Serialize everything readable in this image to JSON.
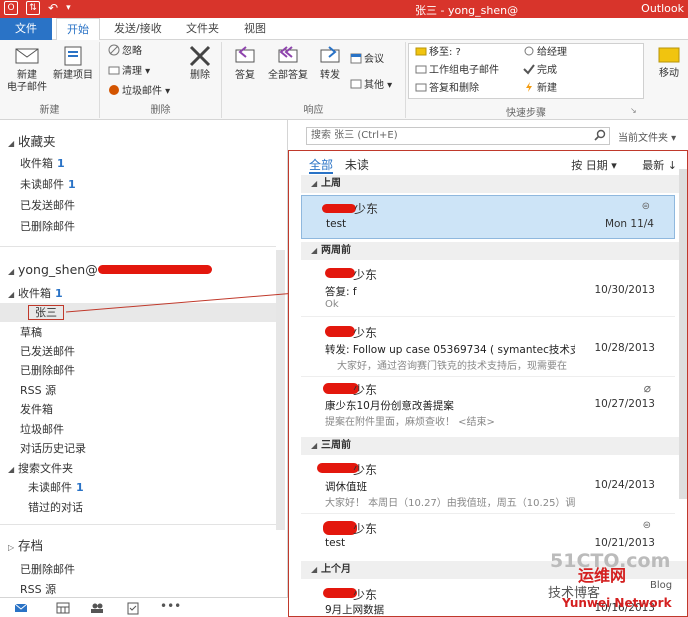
{
  "titlebar": {
    "title": "张三 - yong_shen@",
    "app": "Outlook"
  },
  "tabs": [
    "文件",
    "开始",
    "发送/接收",
    "文件夹",
    "视图"
  ],
  "ribbon": {
    "new_group": {
      "label": "新建",
      "new_email": "新建\n电子邮件",
      "new_items": "新建项目"
    },
    "delete_group": {
      "label": "删除",
      "ignore": "忽略",
      "clean": "清理",
      "junk": "垃圾邮件",
      "delete": "删除"
    },
    "respond_group": {
      "label": "响应",
      "reply": "答复",
      "reply_all": "全部答复",
      "forward": "转发",
      "meeting": "会议",
      "more": "其他"
    },
    "quicksteps_group": {
      "label": "快速步骤",
      "move_to": "移至: ?",
      "to_manager": "给经理",
      "team_email": "工作组电子邮件",
      "done": "完成",
      "reply_delete": "答复和删除",
      "create_new": "新建"
    },
    "move_group": {
      "move": "移动"
    }
  },
  "nav": {
    "favorites_header": "收藏夹",
    "favorites": [
      {
        "label": "收件箱",
        "count": "1"
      },
      {
        "label": "未读邮件",
        "count": "1"
      },
      {
        "label": "已发送邮件",
        "count": ""
      },
      {
        "label": "已删除邮件",
        "count": ""
      }
    ],
    "account": "yong_shen@",
    "inbox": {
      "label": "收件箱",
      "count": "1"
    },
    "subfolder": "张三",
    "folders": [
      "草稿",
      "已发送邮件",
      "已删除邮件",
      "RSS 源",
      "发件箱",
      "垃圾邮件",
      "对话历史记录"
    ],
    "search_folders": "搜索文件夹",
    "search_sub": [
      {
        "label": "未读邮件",
        "count": "1"
      },
      {
        "label": "错过的对话",
        "count": ""
      }
    ],
    "archive": "存档",
    "archive_items": [
      "已删除邮件",
      "RSS 源"
    ]
  },
  "search": {
    "placeholder": "搜索 张三 (Ctrl+E)",
    "scope": "当前文件夹"
  },
  "list": {
    "filter_all": "全部",
    "filter_unread": "未读",
    "sort_by": "按 日期",
    "sort_order": "最新",
    "groups": [
      "上周",
      "两周前",
      "三周前",
      "上个月"
    ],
    "items": [
      {
        "from": "少东",
        "subject": "test",
        "preview": "",
        "date": "Mon 11/4"
      },
      {
        "from": "少东",
        "subject": "答复: f",
        "preview": "Ok",
        "date": "10/30/2013"
      },
      {
        "from": "少东",
        "subject": "转发: Follow up case 05369734 ( symantec技术支...",
        "preview": "大家好，通过咨询赛门铁克的技术支持后，现需要在",
        "date": "10/28/2013"
      },
      {
        "from": "少东",
        "subject": "康少东10月份创意改善提案",
        "preview": "提案在附件里面，麻烦查收！ <结束>",
        "date": "10/27/2013"
      },
      {
        "from": "少东",
        "subject": "调休值班",
        "preview": "大家好！ 本周日（10.27）由我值班，周五（10.25）调",
        "date": "10/24/2013"
      },
      {
        "from": "少东",
        "subject": "test",
        "preview": "",
        "date": "10/21/2013"
      },
      {
        "from": "少东",
        "subject": "9月上网数据",
        "preview": "",
        "date": "10/16/2013"
      }
    ]
  },
  "watermark": {
    "line1": "51CTO.com",
    "line2": "技术博客",
    "line3": "Blog",
    "line4": "Yunwei Network",
    "line5": "运维网"
  },
  "colors": {
    "accent": "#2a73c6",
    "titlebar": "#d8342b",
    "selection": "#cde4f7"
  }
}
